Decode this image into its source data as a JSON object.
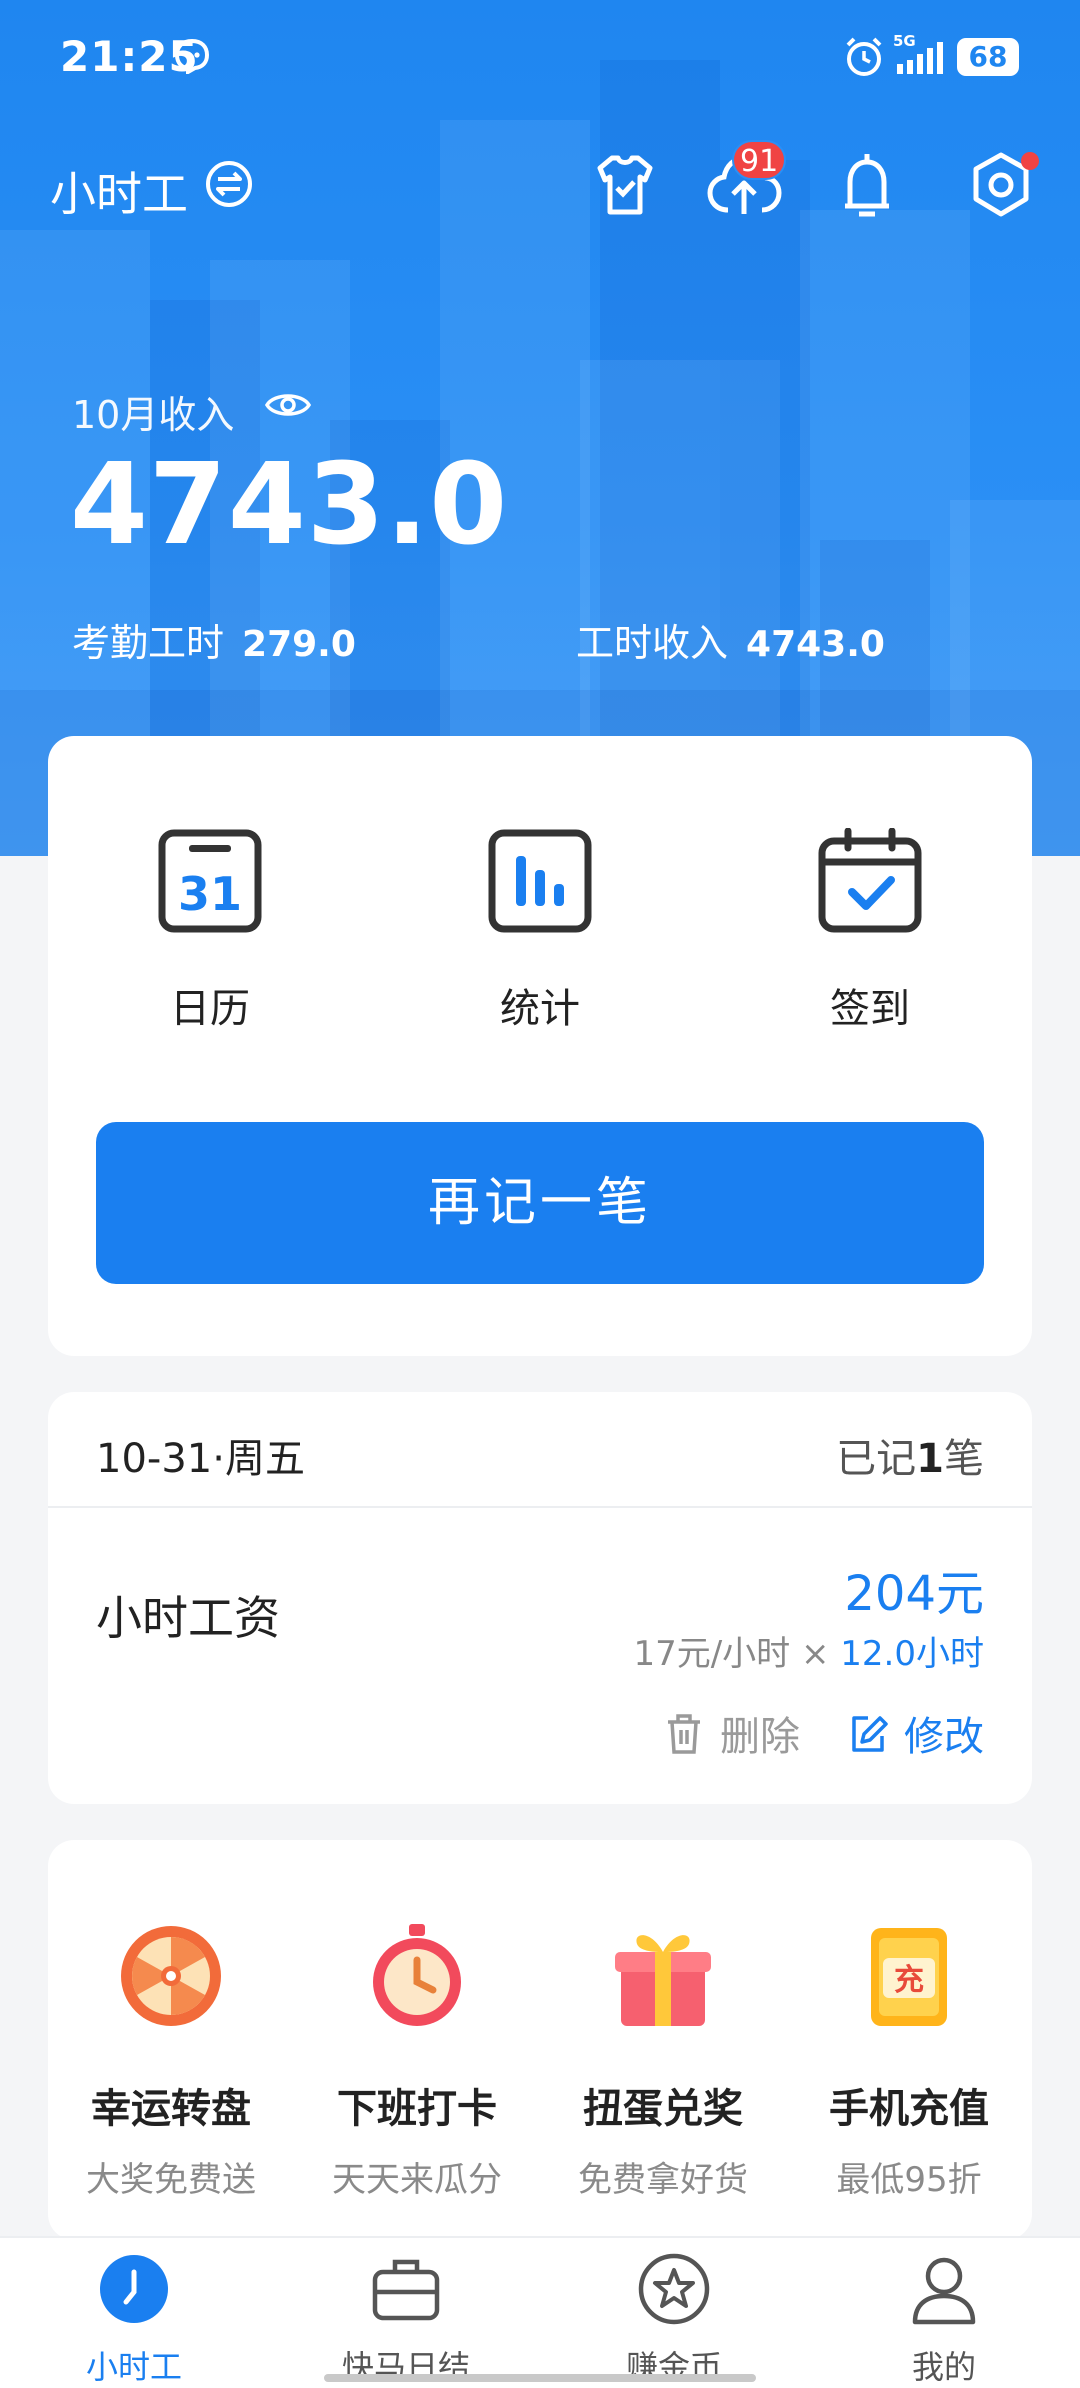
{
  "status_bar": {
    "time": "21:25",
    "network": "5G",
    "battery": "68"
  },
  "app_bar": {
    "title": "小时工",
    "upload_badge": "91"
  },
  "income": {
    "label": "10月收入",
    "amount": "4743.0",
    "attendance_label": "考勤工时",
    "attendance_value": "279.0",
    "hours_income_label": "工时收入",
    "hours_income_value": "4743.0"
  },
  "quick_actions": [
    {
      "label": "日历",
      "icon": "calendar-icon",
      "calendar_day": "31"
    },
    {
      "label": "统计",
      "icon": "bar-chart-icon"
    },
    {
      "label": "签到",
      "icon": "check-in-icon"
    }
  ],
  "primary_button": "再记一笔",
  "record": {
    "date": "10-31·周五",
    "count_prefix": "已记",
    "count_value": "1",
    "count_suffix": "笔",
    "name": "小时工资",
    "total": "204元",
    "rate": "17元/小时",
    "times": "×",
    "hours": "12.0小时",
    "delete_label": "删除",
    "edit_label": "修改"
  },
  "promos": [
    {
      "title": "幸运转盘",
      "subtitle": "大奖免费送",
      "icon": "lucky-wheel-icon"
    },
    {
      "title": "下班打卡",
      "subtitle": "天天来瓜分",
      "icon": "stopwatch-icon"
    },
    {
      "title": "扭蛋兑奖",
      "subtitle": "免费拿好货",
      "icon": "gift-box-icon"
    },
    {
      "title": "手机充值",
      "subtitle": "最低95折",
      "icon": "recharge-card-icon",
      "card_text": "充"
    }
  ],
  "tabs": [
    {
      "label": "小时工",
      "icon": "clock-icon",
      "active": true
    },
    {
      "label": "快马日结",
      "icon": "briefcase-icon"
    },
    {
      "label": "赚金币",
      "icon": "coin-star-icon"
    },
    {
      "label": "我的",
      "icon": "person-icon"
    }
  ],
  "colors": {
    "primary": "#1a7ff0",
    "header": "#1f86f0",
    "badge": "#f04343"
  }
}
